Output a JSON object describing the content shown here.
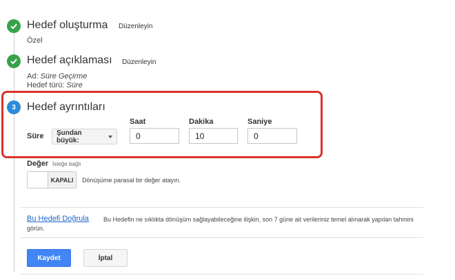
{
  "steps": [
    {
      "number": "",
      "title": "Hedef oluşturma",
      "edit": "Düzenleyin",
      "detail": "Özel"
    },
    {
      "number": "",
      "title": "Hedef açıklaması",
      "edit": "Düzenleyin",
      "detail_lines": [
        {
          "key": "Ad:",
          "value": "Süre Geçirme"
        },
        {
          "key": "Hedef türü:",
          "value": "Süre"
        }
      ]
    },
    {
      "number": "3",
      "title": "Hedef ayrıntıları"
    }
  ],
  "details": {
    "sure_label": "Süre",
    "condition": {
      "selected": "Şundan büyük:"
    },
    "fields": [
      {
        "label": "Saat",
        "value": "0"
      },
      {
        "label": "Dakika",
        "value": "10"
      },
      {
        "label": "Saniye",
        "value": "0"
      }
    ]
  },
  "value": {
    "label": "Değer",
    "optional": "İsteğe bağlı",
    "toggle": "KAPALI",
    "description": "Dönüşüme parasal bir değer atayın."
  },
  "verify": {
    "link": "Bu Hedefi Doğrula",
    "description": "Bu Hedefin ne sıklıkta dönüşüm sağlayabileceğine ilişkin, son 7 güne ait verileriniz temel alınarak yapılan tahmini görün."
  },
  "actions": {
    "save": "Kaydet",
    "cancel": "İptal"
  },
  "colors": {
    "check": "#37a34a",
    "step_active": "#2a8cd8",
    "highlight": "#d9312b",
    "primary": "#4285f4",
    "link": "#1a64c8"
  },
  "icons": [
    "check-icon",
    "caret-down-icon"
  ]
}
